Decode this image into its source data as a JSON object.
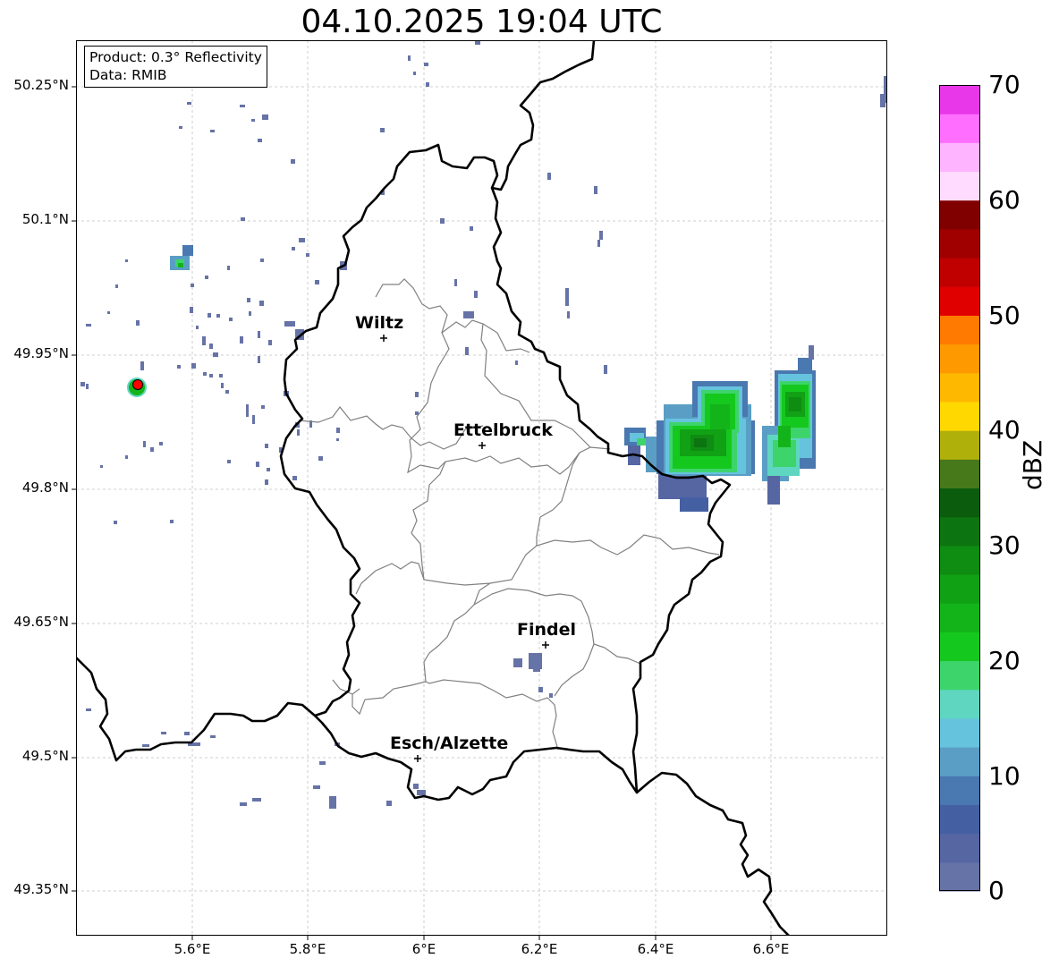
{
  "title": "04.10.2025 19:04 UTC",
  "info": {
    "product": "Product: 0.3° Reflectivity",
    "source": "Data: RMIB"
  },
  "axes": {
    "y_ticks": [
      "50.25°N",
      "50.1°N",
      "49.95°N",
      "49.8°N",
      "49.65°N",
      "49.5°N",
      "49.35°N"
    ],
    "x_ticks": [
      "5.6°E",
      "5.8°E",
      "6°E",
      "6.2°E",
      "6.4°E",
      "6.6°E"
    ]
  },
  "cities": [
    {
      "name": "Wiltz"
    },
    {
      "name": "Ettelbruck"
    },
    {
      "name": "Findel"
    },
    {
      "name": "Esch/Alzette"
    }
  ],
  "colorbar": {
    "unit": "dBZ",
    "ticks": [
      "0",
      "10",
      "20",
      "30",
      "40",
      "50",
      "60",
      "70"
    ],
    "colors": [
      "#6673a6",
      "#5566a3",
      "#4460a3",
      "#4a78b0",
      "#5a9ec5",
      "#66c3de",
      "#5fd6c0",
      "#3dd46c",
      "#15c81e",
      "#13b41a",
      "#11a115",
      "#0f8c12",
      "#0c7410",
      "#0b5c0d",
      "#47781a",
      "#b0b00a",
      "#ffd800",
      "#ffb800",
      "#ff9900",
      "#ff7a00",
      "#e00000",
      "#c00000",
      "#a00000",
      "#800000",
      "#ffdcff",
      "#ffb4ff",
      "#ff6eff",
      "#e837e8"
    ]
  },
  "radar_site_color": "#ff0000",
  "colors": {
    "country_border": "#000000",
    "canton_border": "#808080",
    "grid": "#c0c0c0"
  }
}
